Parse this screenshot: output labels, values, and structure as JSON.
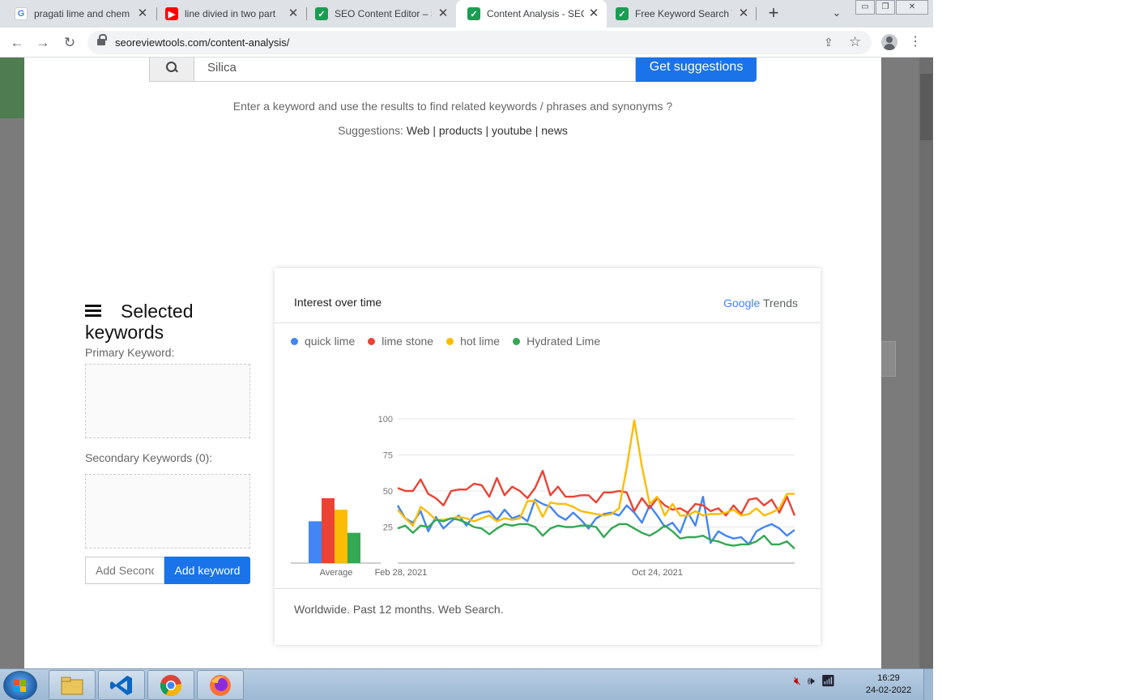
{
  "browser": {
    "tabs": [
      {
        "title": "pragati lime and chem",
        "favicon": "google-g",
        "active": false
      },
      {
        "title": "line divied in two part",
        "favicon": "youtube",
        "active": false
      },
      {
        "title": "SEO Content Editor – S",
        "favicon": "green-check",
        "active": false
      },
      {
        "title": "Content Analysis - SEO",
        "favicon": "green-check",
        "active": true
      },
      {
        "title": "Free Keyword Search V",
        "favicon": "green-check",
        "active": false
      }
    ],
    "url": "seoreviewtools.com/content-analysis/"
  },
  "search": {
    "value": "Silica",
    "button_label": "Get suggestions"
  },
  "helptext": "Enter a keyword and use the results to find related keywords / phrases and synonyms ?",
  "suggestions": {
    "prefix": "Suggestions:",
    "links": [
      "Web",
      "products",
      "youtube",
      "news"
    ]
  },
  "keywords_panel": {
    "title_line1": "Selected",
    "title_line2": "keywords",
    "primary_label": "Primary Keyword:",
    "secondary_label": "Secondary Keywords (0):",
    "add_placeholder": "Add Secondary keyword",
    "add_button": "Add keyword"
  },
  "trends": {
    "title": "Interest over time",
    "brand_google": "Google",
    "brand_trends": "Trends",
    "footer": "Worldwide. Past 12 months. Web Search."
  },
  "chart_data": {
    "type": "line",
    "title": "Interest over time",
    "x_labels": [
      "Feb 28, 2021",
      "Oct 24, 2021"
    ],
    "x_label_positions": [
      0,
      34
    ],
    "average_label": "Average",
    "ylim": [
      0,
      100
    ],
    "yticks": [
      25,
      50,
      75,
      100
    ],
    "grid": true,
    "legend_position": "top-left",
    "series": [
      {
        "name": "quick lime",
        "color": "#4285f4",
        "average": 29,
        "values": [
          40,
          31,
          28,
          36,
          22,
          32,
          24,
          29,
          33,
          26,
          33,
          35,
          36,
          30,
          37,
          31,
          33,
          29,
          44,
          41,
          39,
          33,
          30,
          35,
          30,
          24,
          31,
          34,
          35,
          33,
          40,
          35,
          28,
          40,
          33,
          25,
          28,
          21,
          35,
          26,
          46,
          14,
          22,
          19,
          17,
          18,
          13,
          22,
          25,
          27,
          24,
          19,
          23
        ]
      },
      {
        "name": "lime stone",
        "color": "#ea4335",
        "average": 45,
        "values": [
          52,
          50,
          50,
          58,
          48,
          45,
          40,
          50,
          51,
          51,
          55,
          54,
          46,
          59,
          47,
          53,
          50,
          45,
          52,
          64,
          47,
          53,
          46,
          46,
          47,
          47,
          42,
          49,
          49,
          50,
          49,
          36,
          45,
          38,
          45,
          40,
          37,
          38,
          35,
          41,
          40,
          36,
          38,
          33,
          40,
          34,
          44,
          45,
          40,
          44,
          35,
          46,
          33
        ]
      },
      {
        "name": "hot lime",
        "color": "#fbbc05",
        "average": 37,
        "values": [
          37,
          31,
          26,
          39,
          35,
          30,
          30,
          31,
          32,
          31,
          29,
          31,
          33,
          29,
          31,
          30,
          31,
          43,
          43,
          32,
          42,
          41,
          41,
          39,
          36,
          35,
          34,
          33,
          34,
          38,
          66,
          99,
          67,
          41,
          46,
          33,
          41,
          33,
          33,
          36,
          33,
          34,
          34,
          35,
          37,
          33,
          34,
          38,
          33,
          35,
          38,
          48,
          48
        ]
      },
      {
        "name": "Hydrated Lime",
        "color": "#34a853",
        "average": 21,
        "values": [
          24,
          26,
          21,
          26,
          25,
          30,
          29,
          31,
          30,
          28,
          25,
          24,
          20,
          24,
          27,
          26,
          27,
          27,
          25,
          19,
          24,
          26,
          25,
          25,
          26,
          26,
          25,
          18,
          24,
          27,
          27,
          24,
          21,
          19,
          22,
          26,
          22,
          17,
          18,
          18,
          19,
          16,
          15,
          13,
          12,
          13,
          13,
          15,
          19,
          13,
          13,
          15,
          10
        ]
      }
    ]
  },
  "taskbar": {
    "apps": [
      "file-explorer",
      "vscode",
      "chrome",
      "firefox"
    ],
    "time": "16:29",
    "date": "24-02-2022"
  }
}
